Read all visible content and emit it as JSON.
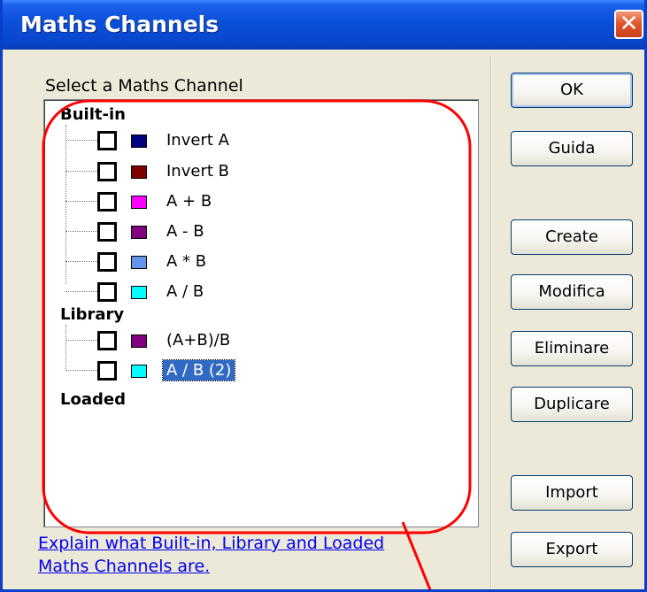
{
  "window": {
    "title": "Maths Channels"
  },
  "icons": {
    "close": "close-icon"
  },
  "label": "Select a Maths Channel",
  "groups": {
    "builtin": {
      "label": "Built-in",
      "items": [
        {
          "label": "Invert A",
          "color": "#000080",
          "checked": false
        },
        {
          "label": "Invert B",
          "color": "#800000",
          "checked": false
        },
        {
          "label": "A + B",
          "color": "#FF00FF",
          "checked": false
        },
        {
          "label": "A - B",
          "color": "#800080",
          "checked": false
        },
        {
          "label": "A * B",
          "color": "#6495ED",
          "checked": false
        },
        {
          "label": "A / B",
          "color": "#00FFFF",
          "checked": false
        }
      ]
    },
    "library": {
      "label": "Library",
      "items": [
        {
          "label": "(A+B)/B",
          "color": "#800080",
          "checked": false
        },
        {
          "label": "A / B (2)",
          "color": "#00FFFF",
          "checked": false,
          "selected": true
        }
      ]
    },
    "loaded": {
      "label": "Loaded",
      "items": []
    }
  },
  "buttons": {
    "ok": "OK",
    "help": "Guida",
    "create": "Create",
    "edit": "Modifica",
    "delete": "Eliminare",
    "duplicate": "Duplicare",
    "import": "Import",
    "export": "Export"
  },
  "help_link": "Explain what Built-in, Library and Loaded Maths Channels are.",
  "colors": {
    "titlebar": "#0A4FD8",
    "annotation": "#FF0000",
    "selection": "#316AC5"
  }
}
